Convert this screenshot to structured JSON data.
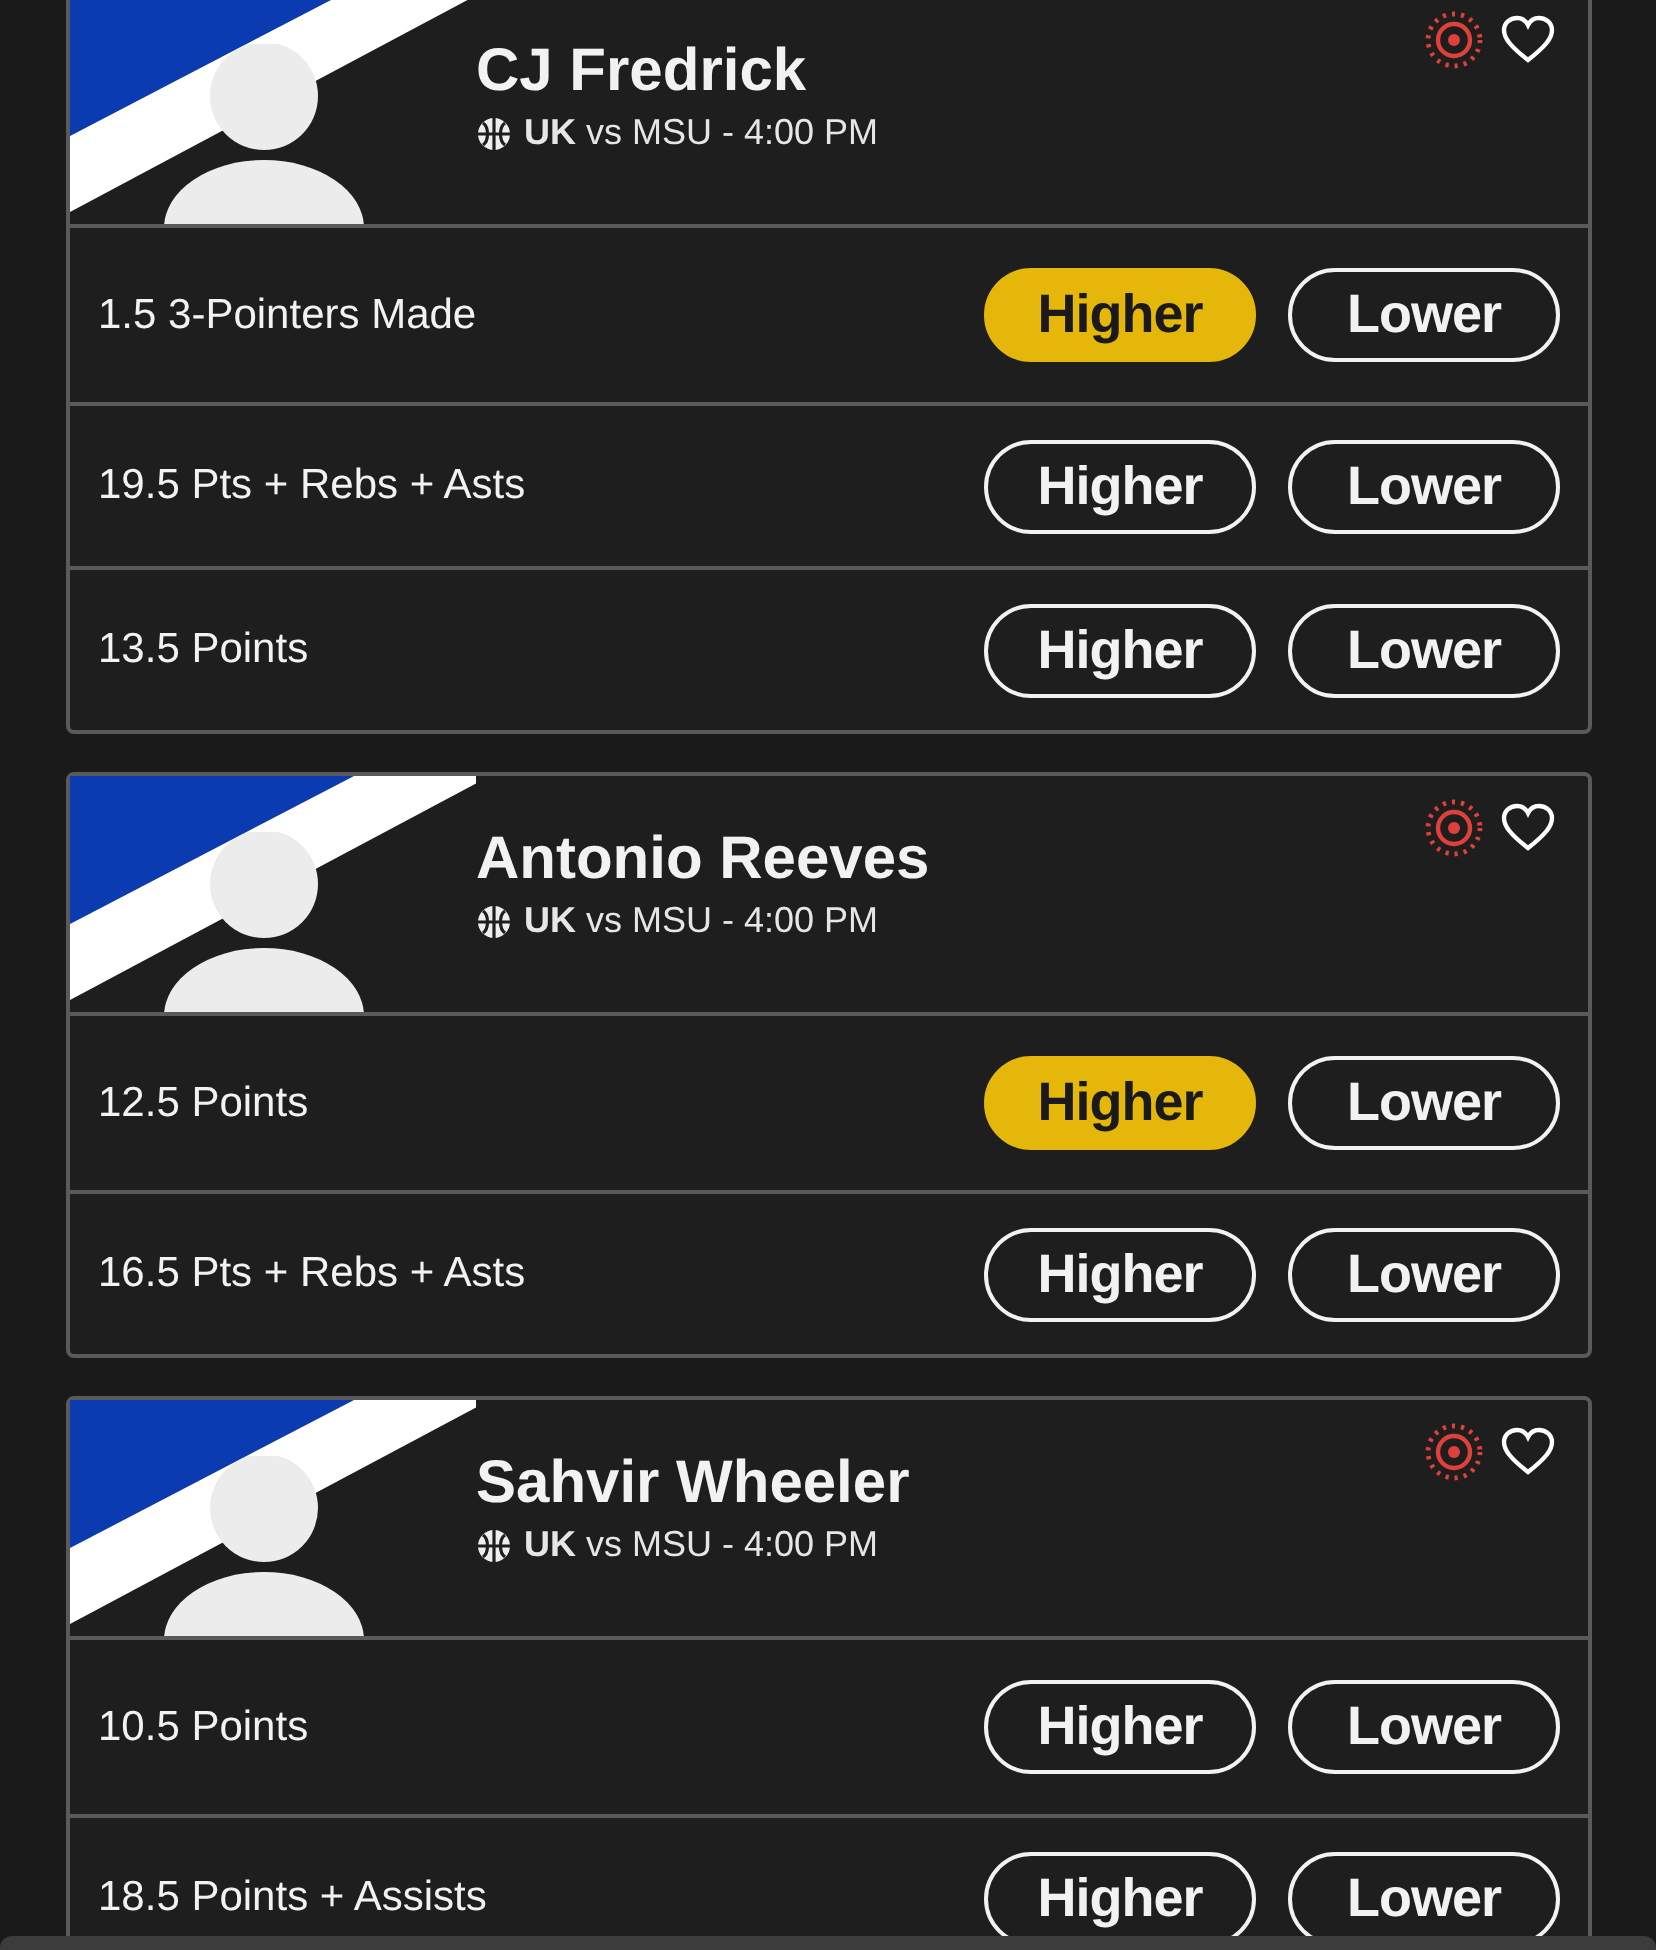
{
  "players": [
    {
      "name": "CJ Fredrick",
      "game": "**UK** vs MSU - 4:00 PM",
      "props": [
        {
          "line": "1.5 3-Pointers Made",
          "options": [
            {
              "label": "Higher",
              "selected": true
            },
            {
              "label": "Lower",
              "selected": false
            }
          ]
        },
        {
          "line": "19.5 Pts + Rebs + Asts",
          "options": [
            {
              "label": "Higher",
              "selected": false
            },
            {
              "label": "Lower",
              "selected": false
            }
          ]
        },
        {
          "line": "13.5 Points",
          "options": [
            {
              "label": "Higher",
              "selected": false
            },
            {
              "label": "Lower",
              "selected": false
            }
          ]
        }
      ]
    },
    {
      "name": "Antonio Reeves",
      "game": "**UK** vs MSU - 4:00 PM",
      "props": [
        {
          "line": "12.5 Points",
          "options": [
            {
              "label": "Higher",
              "selected": true
            },
            {
              "label": "Lower",
              "selected": false
            }
          ]
        },
        {
          "line": "16.5 Pts + Rebs + Asts",
          "options": [
            {
              "label": "Higher",
              "selected": false
            },
            {
              "label": "Lower",
              "selected": false
            }
          ]
        }
      ]
    },
    {
      "name": "Sahvir Wheeler",
      "game": "**UK** vs MSU - 4:00 PM",
      "props": [
        {
          "line": "10.5 Points",
          "options": [
            {
              "label": "Higher",
              "selected": false
            },
            {
              "label": "Lower",
              "selected": false
            }
          ]
        },
        {
          "line": "18.5 Points + Assists",
          "options": [
            {
              "label": "Higher",
              "selected": false
            },
            {
              "label": "Lower",
              "selected": false
            }
          ]
        }
      ]
    }
  ]
}
